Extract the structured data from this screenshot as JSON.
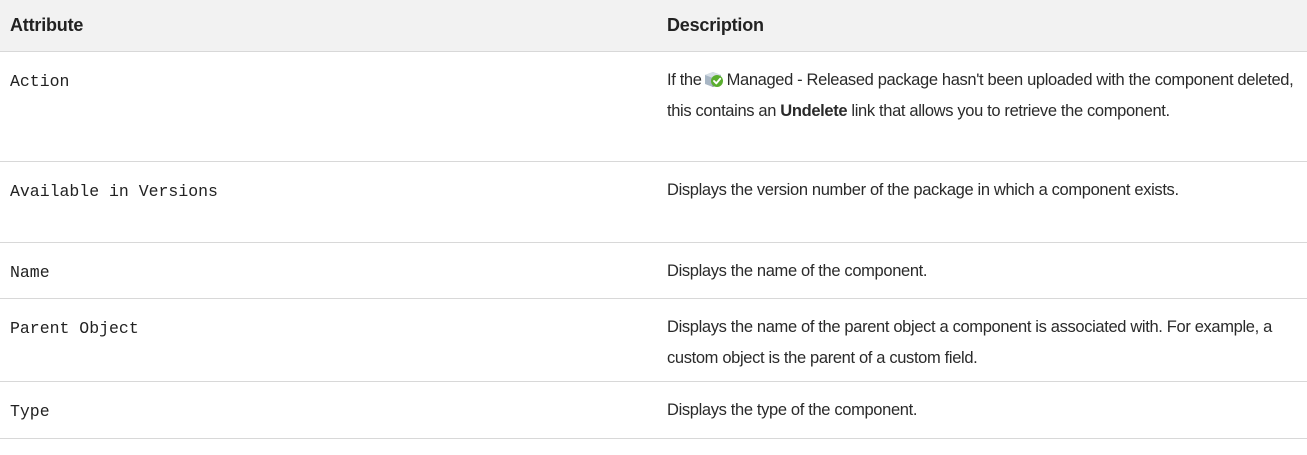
{
  "table": {
    "headers": {
      "attribute": "Attribute",
      "description": "Description"
    },
    "rows": [
      {
        "attribute": "Action",
        "description": {
          "before_icon": "If the",
          "icon": "managed-released-package-icon",
          "after_icon": "Managed - Released package hasn't been uploaded with the component deleted, this contains an",
          "strong": "Undelete",
          "after_strong": "link that allows you to retrieve the component."
        }
      },
      {
        "attribute": "Available in Versions",
        "description": "Displays the version number of the package in which a component exists."
      },
      {
        "attribute": "Name",
        "description": "Displays the name of the component."
      },
      {
        "attribute": "Parent Object",
        "description": "Displays the name of the parent object a component is associated with. For example, a custom object is the parent of a custom field."
      },
      {
        "attribute": "Type",
        "description": "Displays the type of the component."
      }
    ]
  }
}
